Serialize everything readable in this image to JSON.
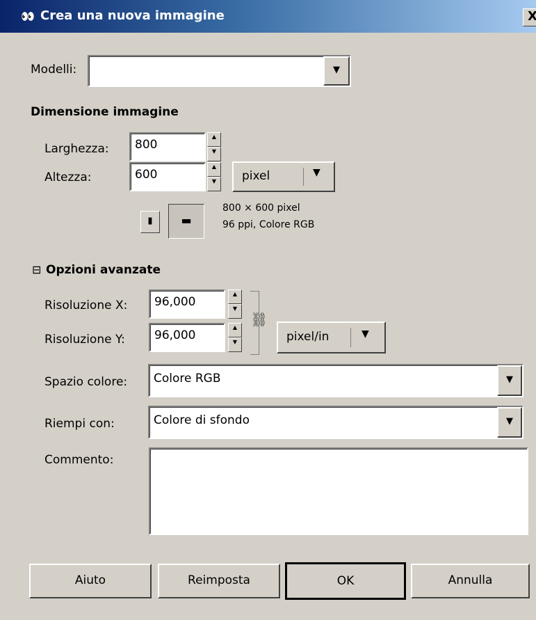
{
  "window": {
    "title": "Crea una nuova immagine",
    "icon": "gimp-wilber-icon",
    "close_label": "X"
  },
  "templates": {
    "label": "Modelli:",
    "value": ""
  },
  "image_size": {
    "heading": "Dimensione immagine",
    "width_label": "Larghezza:",
    "width_value": "800",
    "height_label": "Altezza:",
    "height_value": "600",
    "unit": "pixel",
    "info_line1": "800 × 600 pixel",
    "info_line2": "96 ppi, Colore RGB"
  },
  "advanced": {
    "toggle": "⊟",
    "heading": "Opzioni avanzate",
    "xres_label": "Risoluzione X:",
    "xres_value": "96,000",
    "yres_label": "Risoluzione Y:",
    "yres_value": "96,000",
    "res_unit": "pixel/in",
    "colorspace_label": "Spazio colore:",
    "colorspace_value": "Colore RGB",
    "fill_label": "Riempi con:",
    "fill_value": "Colore di sfondo",
    "comment_label": "Commento:",
    "comment_value": ""
  },
  "buttons": {
    "help": "Aiuto",
    "reset": "Reimposta",
    "ok": "OK",
    "cancel": "Annulla"
  }
}
